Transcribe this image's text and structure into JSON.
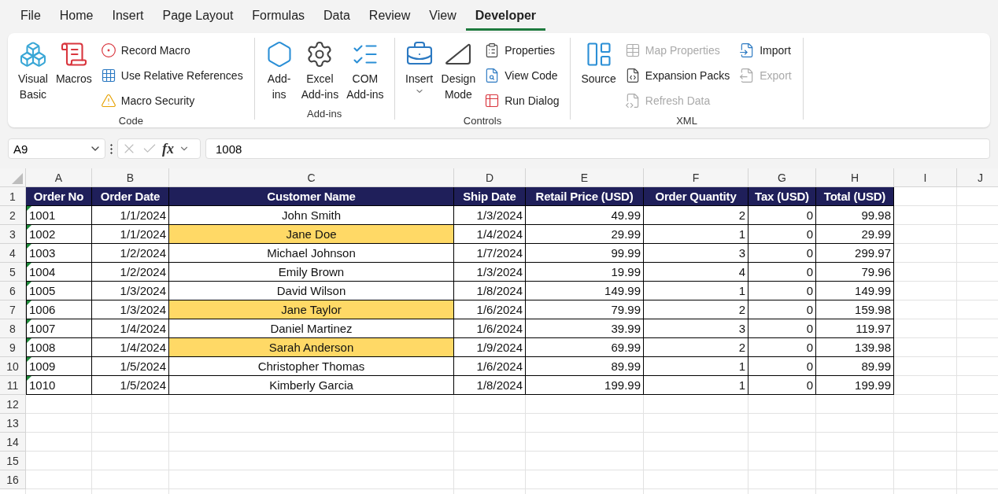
{
  "menu_tabs": [
    {
      "label": "File",
      "selected": false
    },
    {
      "label": "Home",
      "selected": false
    },
    {
      "label": "Insert",
      "selected": false
    },
    {
      "label": "Page Layout",
      "selected": false
    },
    {
      "label": "Formulas",
      "selected": false
    },
    {
      "label": "Data",
      "selected": false
    },
    {
      "label": "Review",
      "selected": false
    },
    {
      "label": "View",
      "selected": false
    },
    {
      "label": "Developer",
      "selected": true
    }
  ],
  "ribbon": {
    "groups": [
      {
        "label": "Code",
        "items": [
          {
            "kind": "large",
            "label": "Visual\nBasic",
            "disabled": false
          },
          {
            "kind": "large",
            "label": "Macros",
            "disabled": false
          },
          {
            "kind": "small",
            "label": "Record Macro",
            "disabled": false
          },
          {
            "kind": "small",
            "label": "Use Relative References",
            "disabled": false
          },
          {
            "kind": "small",
            "label": "Macro Security",
            "disabled": false
          }
        ]
      },
      {
        "label": "Add-ins",
        "items": [
          {
            "kind": "large",
            "label": "Add-\nins",
            "disabled": false
          },
          {
            "kind": "large",
            "label": "Excel\nAdd-ins",
            "disabled": false
          },
          {
            "kind": "large",
            "label": "COM\nAdd-ins",
            "disabled": false
          }
        ]
      },
      {
        "label": "Controls",
        "items": [
          {
            "kind": "large",
            "label": "Insert",
            "disabled": false,
            "dropdown": true
          },
          {
            "kind": "large",
            "label": "Design\nMode",
            "disabled": false
          },
          {
            "kind": "small",
            "label": "Properties",
            "disabled": false
          },
          {
            "kind": "small",
            "label": "View Code",
            "disabled": false
          },
          {
            "kind": "small",
            "label": "Run Dialog",
            "disabled": false
          }
        ]
      },
      {
        "label": "XML",
        "items": [
          {
            "kind": "large",
            "label": "Source",
            "disabled": false
          },
          {
            "kind": "small",
            "label": "Map Properties",
            "disabled": true
          },
          {
            "kind": "small",
            "label": "Expansion Packs",
            "disabled": false
          },
          {
            "kind": "small",
            "label": "Refresh Data",
            "disabled": true
          },
          {
            "kind": "small",
            "label": "Import",
            "disabled": false
          },
          {
            "kind": "small",
            "label": "Export",
            "disabled": true
          }
        ]
      }
    ]
  },
  "formula_bar": {
    "name_box": "A9",
    "function_label": "fx",
    "value": "1008"
  },
  "sheet": {
    "column_letters": [
      "A",
      "B",
      "C",
      "D",
      "E",
      "F",
      "G",
      "H",
      "I",
      "J"
    ],
    "row_numbers": [
      "1",
      "2",
      "3",
      "4",
      "5",
      "6",
      "7",
      "8",
      "9",
      "10",
      "11",
      "12",
      "13",
      "14",
      "15",
      "16"
    ],
    "table": {
      "columns": [
        "Order No",
        "Order Date",
        "Customer Name",
        "Ship Date",
        "Retail Price (USD)",
        "Order Quantity",
        "Tax (USD)",
        "Total (USD)"
      ],
      "rows": [
        {
          "cells": [
            "1001",
            "1/1/2024",
            "John Smith",
            "1/3/2024",
            "49.99",
            "2",
            "0",
            "99.98"
          ],
          "highlighted": false,
          "number_as_text": true
        },
        {
          "cells": [
            "1002",
            "1/1/2024",
            "Jane Doe",
            "1/4/2024",
            "29.99",
            "1",
            "0",
            "29.99"
          ],
          "highlighted": true,
          "number_as_text": true
        },
        {
          "cells": [
            "1003",
            "1/2/2024",
            "Michael Johnson",
            "1/7/2024",
            "99.99",
            "3",
            "0",
            "299.97"
          ],
          "highlighted": false,
          "number_as_text": true
        },
        {
          "cells": [
            "1004",
            "1/2/2024",
            "Emily Brown",
            "1/3/2024",
            "19.99",
            "4",
            "0",
            "79.96"
          ],
          "highlighted": false,
          "number_as_text": true
        },
        {
          "cells": [
            "1005",
            "1/3/2024",
            "David Wilson",
            "1/8/2024",
            "149.99",
            "1",
            "0",
            "149.99"
          ],
          "highlighted": false,
          "number_as_text": true
        },
        {
          "cells": [
            "1006",
            "1/3/2024",
            "Jane Taylor",
            "1/6/2024",
            "79.99",
            "2",
            "0",
            "159.98"
          ],
          "highlighted": true,
          "number_as_text": true
        },
        {
          "cells": [
            "1007",
            "1/4/2024",
            "Daniel Martinez",
            "1/6/2024",
            "39.99",
            "3",
            "0",
            "119.97"
          ],
          "highlighted": false,
          "number_as_text": true
        },
        {
          "cells": [
            "1008",
            "1/4/2024",
            "Sarah Anderson",
            "1/9/2024",
            "69.99",
            "2",
            "0",
            "139.98"
          ],
          "highlighted": true,
          "number_as_text": true
        },
        {
          "cells": [
            "1009",
            "1/5/2024",
            "Christopher Thomas",
            "1/6/2024",
            "89.99",
            "1",
            "0",
            "89.99"
          ],
          "highlighted": false,
          "number_as_text": true
        },
        {
          "cells": [
            "1010",
            "1/5/2024",
            "Kimberly Garcia",
            "1/8/2024",
            "199.99",
            "1",
            "0",
            "199.99"
          ],
          "highlighted": false,
          "number_as_text": true
        }
      ]
    }
  }
}
